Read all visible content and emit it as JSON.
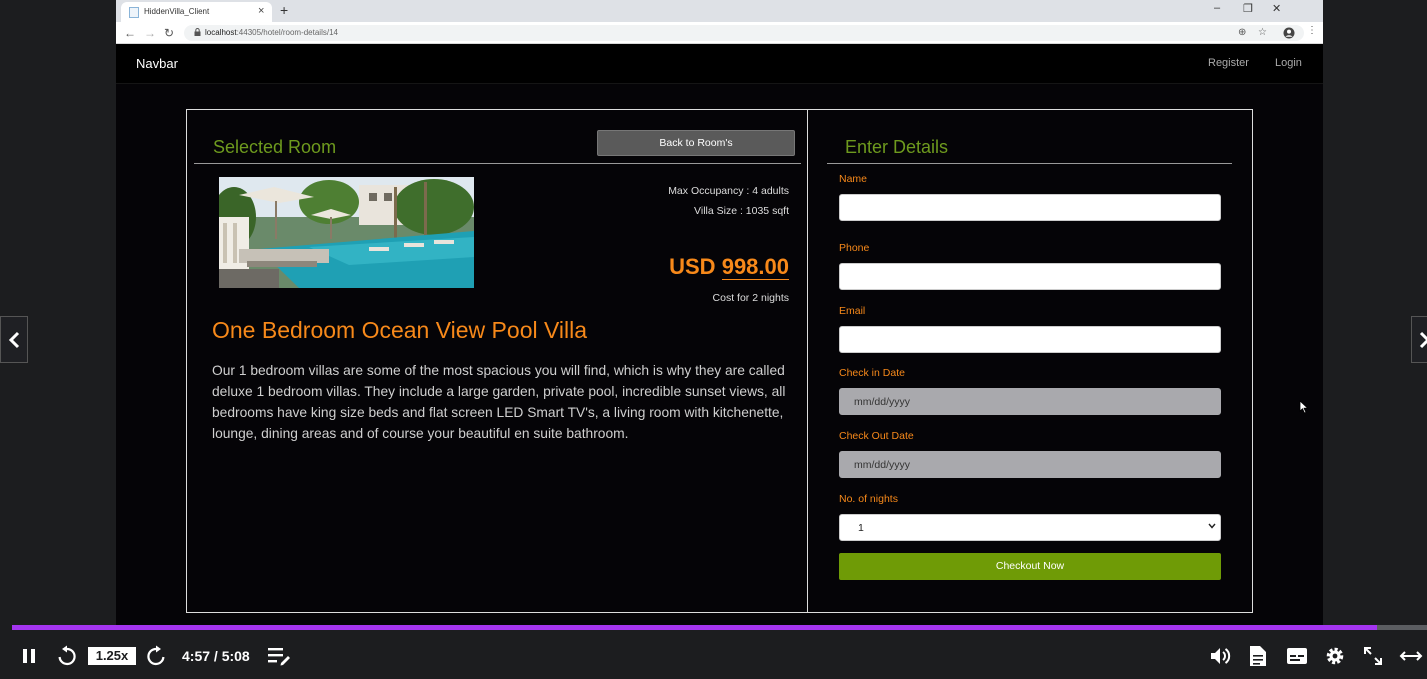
{
  "browser": {
    "tab_title": "HiddenVilla_Client",
    "tab_close": "×",
    "new_tab": "+",
    "minimize": "–",
    "restore": "❐",
    "close": "✕",
    "back": "←",
    "forward": "→",
    "reload": "↻",
    "url_host": "localhost",
    "url_rest": ":44305/hotel/room-details/14",
    "zoom_icon": "⊕",
    "star_icon": "☆",
    "menu_icon": "⋮"
  },
  "navbar": {
    "brand": "Navbar",
    "register": "Register",
    "login": "Login"
  },
  "room": {
    "heading": "Selected Room",
    "back_label": "Back to Room's",
    "max_occupancy": "Max Occupancy : 4 adults",
    "villa_size": "Villa Size : 1035 sqft",
    "price_currency": "USD",
    "price_amount": "998.00",
    "cost_note": "Cost for 2 nights",
    "name": "One Bedroom Ocean View Pool Villa",
    "description": "Our 1 bedroom villas are some of the most spacious you will find, which is why they are called deluxe 1 bedroom villas. They include a large garden, private pool, incredible sunset views, all bedrooms have king size beds and flat screen LED Smart TV's, a living room with kitchenette, lounge, dining areas and of course your beautiful en suite bathroom."
  },
  "details": {
    "heading": "Enter Details",
    "name_label": "Name",
    "name_value": "",
    "phone_label": "Phone",
    "phone_value": "",
    "email_label": "Email",
    "email_value": "",
    "checkin_label": "Check in Date",
    "checkin_placeholder": "mm/dd/yyyy",
    "checkout_label": "Check Out Date",
    "checkout_placeholder": "mm/dd/yyyy",
    "nights_label": "No. of nights",
    "nights_value": "1",
    "checkout_button": "Checkout Now"
  },
  "player": {
    "speed": "1.25x",
    "time": "4:57 / 5:08",
    "progress_fraction": 0.965
  },
  "colors": {
    "accent_green": "#6f9b06",
    "heading_green": "#6e9a1e",
    "accent_orange": "#f7891a",
    "progress_purple": "#a435f0"
  },
  "icons": {
    "prev": "chevron-left-icon",
    "next": "chevron-right-icon",
    "pause": "pause-icon",
    "rewind": "rewind-5-icon",
    "forward": "forward-5-icon",
    "playlist": "playlist-icon",
    "volume": "volume-icon",
    "transcript": "transcript-icon",
    "captions": "captions-icon",
    "settings": "gear-icon",
    "fullscreen": "fullscreen-icon",
    "expand": "expand-icon"
  }
}
